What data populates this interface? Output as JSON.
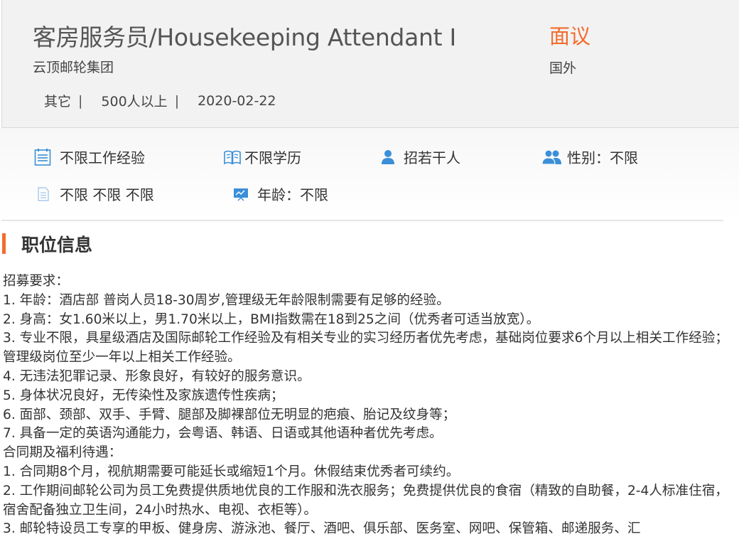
{
  "job": {
    "title": "客房服务员/Housekeeping Attendant I",
    "salary": "面议",
    "company": "云顶邮轮集团",
    "location": "国外",
    "meta": {
      "industry": "其它",
      "size": "500人以上",
      "date": "2020-02-22",
      "separator": "|"
    }
  },
  "requirements": {
    "experience": "不限工作经验",
    "education": "不限学历",
    "headcount": "招若干人",
    "gender": "性别：不限",
    "other": "不限 不限 不限",
    "age": "年龄：不限"
  },
  "section": {
    "title": "职位信息"
  },
  "description": [
    "招募要求：",
    "1. 年龄：酒店部 普岗人员18-30周岁,管理级无年龄限制需要有足够的经验。",
    "2. 身高：女1.60米以上，男1.70米以上，BMI指数需在18到25之间（优秀者可适当放宽）。",
    "3. 专业不限，具星级酒店及国际邮轮工作经验及有相关专业的实习经历者优先考虑，基础岗位要求6个月以上相关工作经验；管理级岗位至少一年以上相关工作经验。",
    "4. 无违法犯罪记录、形象良好，有较好的服务意识。",
    "5. 身体状况良好，无传染性及家族遗传性疾病；",
    "6. 面部、颈部、双手、手臂、腿部及脚裸部位无明显的疤痕、胎记及纹身等；",
    "7. 具备一定的英语沟通能力，会粤语、韩语、日语或其他语种者优先考虑。",
    "合同期及福利待遇：",
    "1. 合同期8个月，视航期需要可能延长或缩短1个月。休假结束优秀者可续约。",
    "2. 工作期间邮轮公司为员工免费提供质地优良的工作服和洗衣服务；免费提供优良的食宿（精致的自助餐，2-4人标准住宿，宿舍配备独立卫生间，24小时热水、电视、衣柜等）。",
    "3. 邮轮特设员工专享的甲板、健身房、游泳池、餐厅、酒吧、俱乐部、医务室、网吧、保管箱、邮递服务、汇"
  ],
  "colors": {
    "accent": "#f26c2d",
    "icon_blue": "#3b8fd8",
    "icon_light": "#a9c9ea"
  }
}
